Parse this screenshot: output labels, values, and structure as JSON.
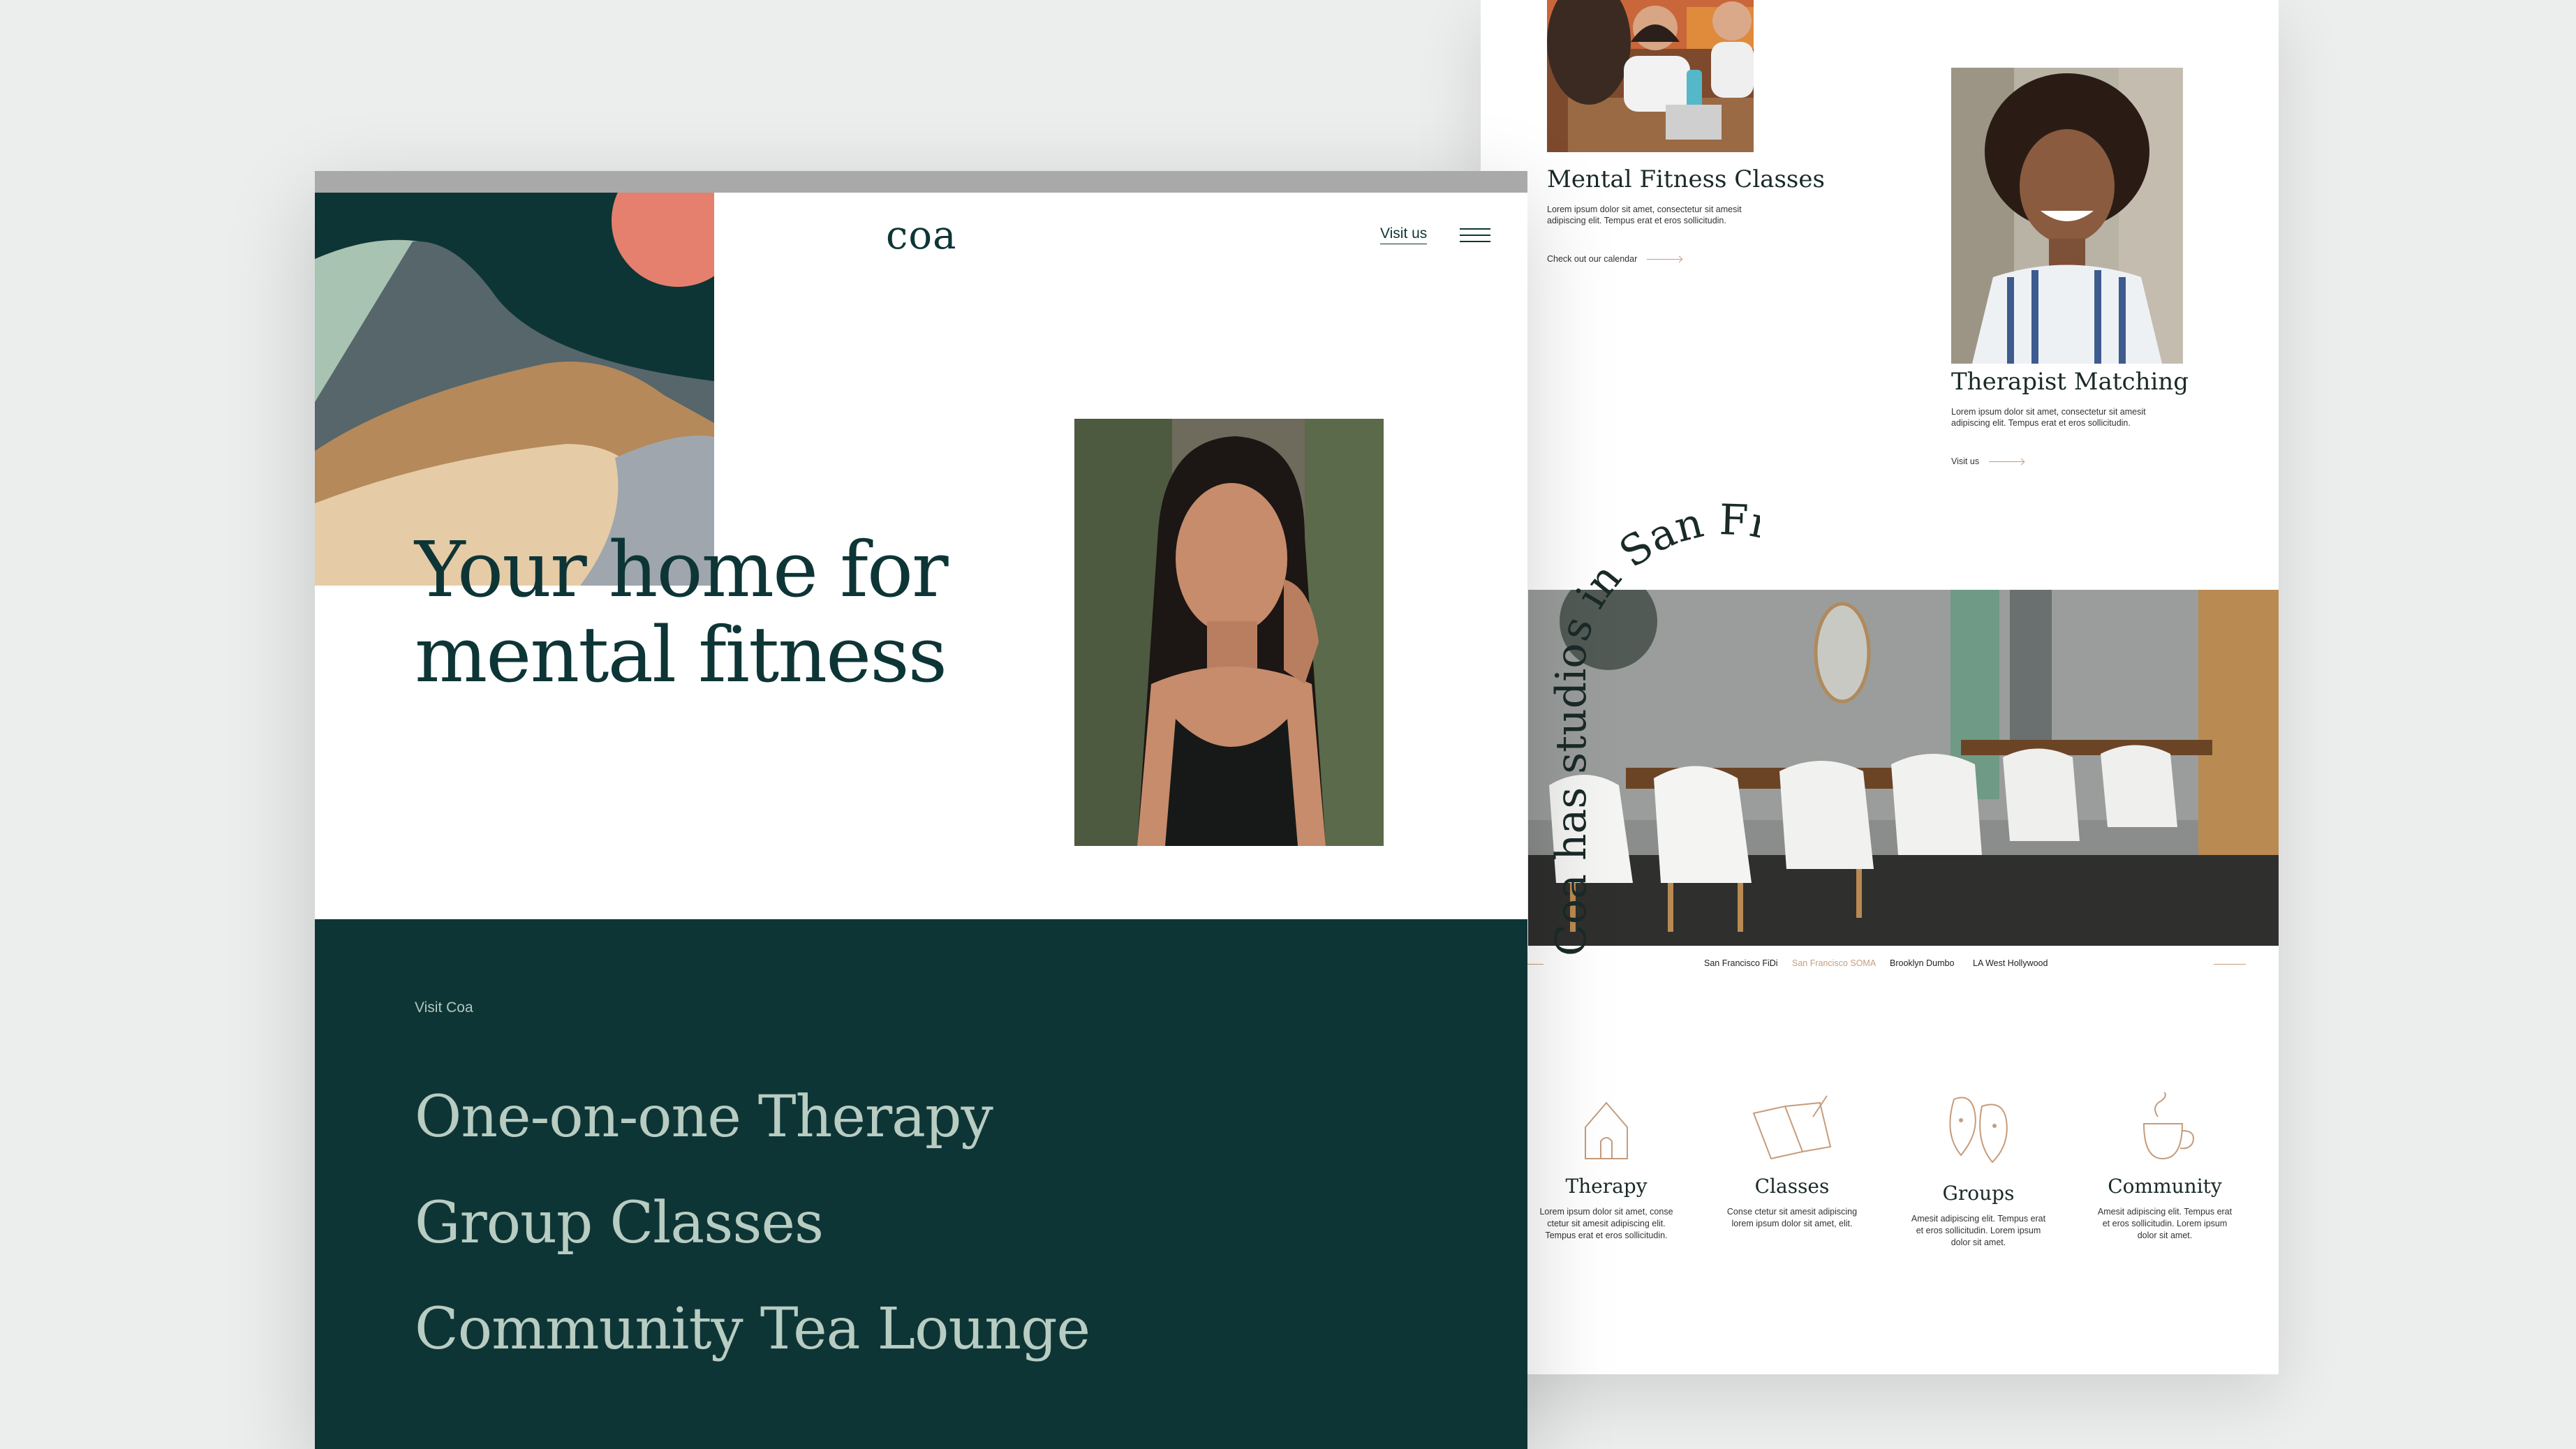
{
  "hero": {
    "logo": "coa",
    "visit_link": "Visit us",
    "headline_line1": "Your home for",
    "headline_line2": "mental fitness"
  },
  "services_section": {
    "eyebrow": "Visit Coa",
    "items": [
      "One-on-one Therapy",
      "Group Classes",
      "Community Tea Lounge"
    ]
  },
  "cards": {
    "mental_fitness": {
      "title": "Mental Fitness Classes",
      "desc_line1": "Lorem ipsum dolor sit amet, consectetur sit amesit",
      "desc_line2": "adipiscing elit.  Tempus erat et eros sollicitudin.",
      "link": "Check out our calendar"
    },
    "therapist": {
      "title": "Therapist Matching",
      "desc_line1": "Lorem ipsum dolor sit amet, consectetur sit amesit",
      "desc_line2": "adipiscing elit.  Tempus erat et eros sollicitudin.",
      "link": "Visit us"
    }
  },
  "studios": {
    "arc_text": "Coa has studios in San Francisco, I",
    "locations": [
      "San Francisco FiDi",
      "San Francisco SOMA",
      "Brooklyn Dumbo",
      "LA West Hollywood"
    ],
    "active_location": "San Francisco SOMA"
  },
  "features": [
    {
      "label": "Therapy",
      "icon": "house-icon",
      "desc": [
        "Lorem ipsum dolor sit amet, conse",
        "ctetur sit amesit adipiscing elit.",
        "Tempus erat et eros sollicitudin."
      ]
    },
    {
      "label": "Classes",
      "icon": "notebook-icon",
      "desc": [
        "Conse ctetur sit amesit adipiscing",
        "lorem ipsum dolor sit amet, elit."
      ]
    },
    {
      "label": "Groups",
      "icon": "faces-icon",
      "desc": [
        "Amesit adipiscing elit. Tempus erat",
        "et eros sollicitudin. Lorem ipsum",
        "dolor sit amet."
      ]
    },
    {
      "label": "Community",
      "icon": "teacup-icon",
      "desc": [
        "Amesit adipiscing elit. Tempus erat",
        "et eros sollicitudin. Lorem ipsum",
        "dolor sit amet."
      ]
    }
  ],
  "colors": {
    "dark_green": "#0e3536",
    "sage_text": "#b8ccc2",
    "accent_tan": "#c69c7c",
    "coral": "#e4806d"
  }
}
